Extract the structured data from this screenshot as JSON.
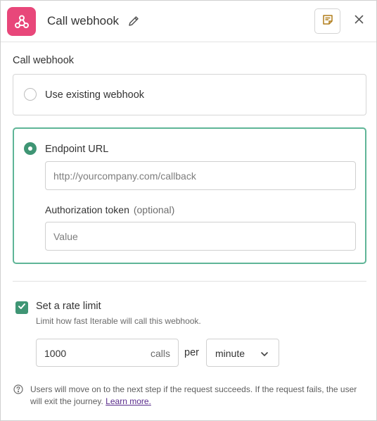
{
  "header": {
    "title": "Call webhook",
    "app_icon": "webhook-icon",
    "edit_icon": "pencil-icon",
    "notes_icon": "note-icon",
    "close_icon": "close-icon",
    "accent_color": "#e8477a"
  },
  "section": {
    "label": "Call webhook"
  },
  "options": {
    "existing": {
      "label": "Use existing webhook",
      "selected": false
    },
    "endpoint": {
      "label": "Endpoint URL",
      "selected": true,
      "url_placeholder": "http://yourcompany.com/callback",
      "url_value": "",
      "auth_label": "Authorization token",
      "auth_optional": "(optional)",
      "auth_placeholder": "Value",
      "auth_value": ""
    }
  },
  "rate_limit": {
    "enabled": true,
    "label": "Set a rate limit",
    "help": "Limit how fast Iterable will call this webhook.",
    "calls_value": "1000",
    "calls_unit": "calls",
    "per_label": "per",
    "period": "minute"
  },
  "footer": {
    "info_text": "Users will move on to the next step if the request succeeds. If the request fails, the user will exit the journey.",
    "link_text": "Learn more."
  },
  "colors": {
    "selected_border": "#5fb597",
    "checked_green": "#3f9574",
    "link": "#5a2d8c"
  }
}
